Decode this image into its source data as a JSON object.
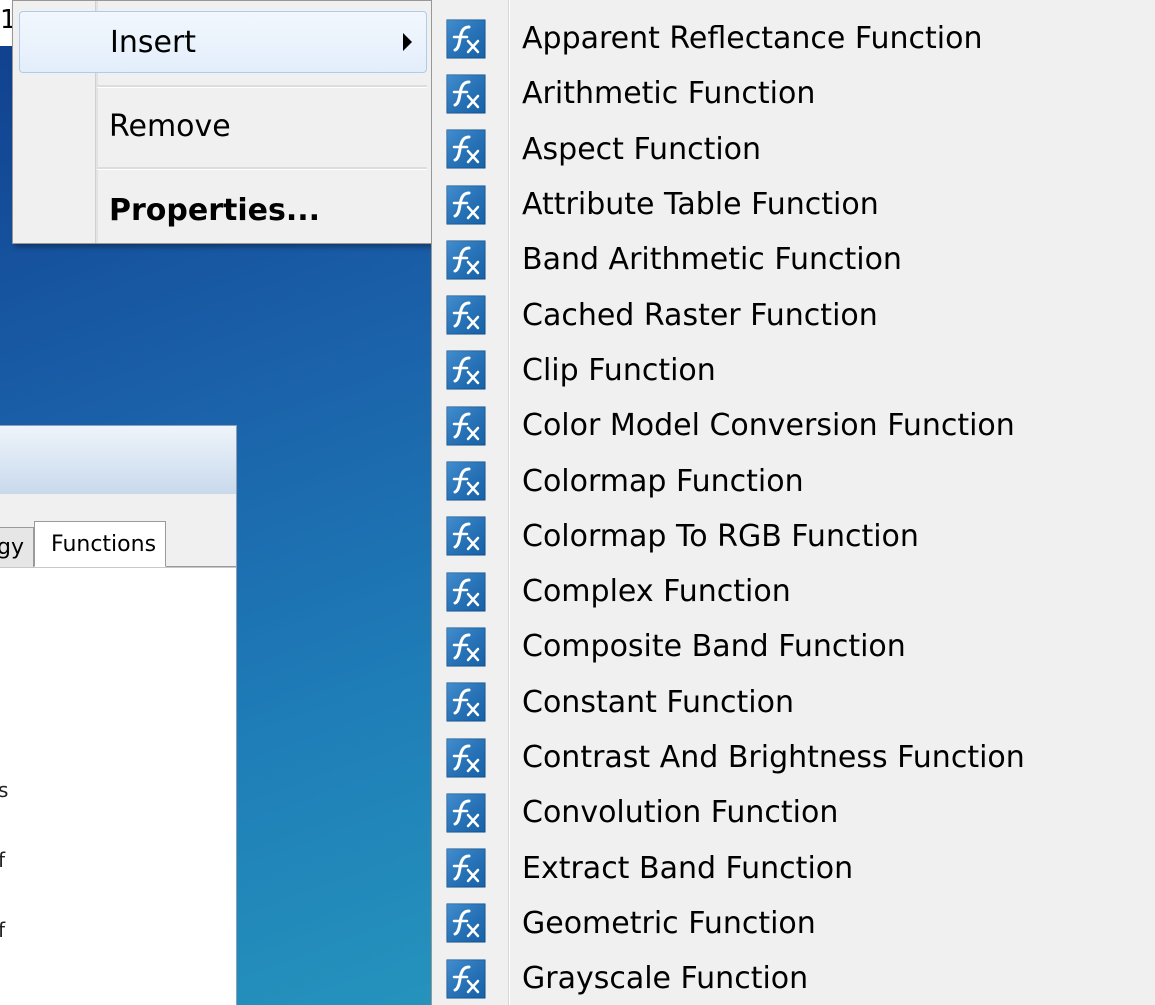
{
  "context_menu": {
    "items": [
      {
        "label": "Insert",
        "has_submenu": true,
        "highlighted": true
      },
      {
        "label": "Remove"
      },
      {
        "label": "Properties...",
        "bold": true
      }
    ]
  },
  "submenu": {
    "icon": "function-fx-icon",
    "items": [
      "Apparent Reflectance Function",
      "Arithmetic Function",
      "Aspect Function",
      "Attribute Table Function",
      "Band Arithmetic Function",
      "Cached Raster Function",
      "Clip Function",
      "Color Model Conversion Function",
      "Colormap Function",
      "Colormap To RGB Function",
      "Complex Function",
      "Composite Band Function",
      "Constant Function",
      "Contrast And Brightness Function",
      "Convolution Function",
      "Extract Band Function",
      "Geometric Function",
      "Grayscale Function"
    ]
  },
  "background_window": {
    "tabs": [
      {
        "label": "gy",
        "clipped": true
      },
      {
        "label": "Functions",
        "active": true
      }
    ],
    "content_fragments": [
      "s",
      "f",
      "f"
    ]
  },
  "top_fragment": "1",
  "colors": {
    "menu_bg": "#f0f0f0",
    "highlight_border": "#aecbed",
    "icon_blue": "#1d6fb5",
    "desktop_blue": "#1f7fb8"
  }
}
